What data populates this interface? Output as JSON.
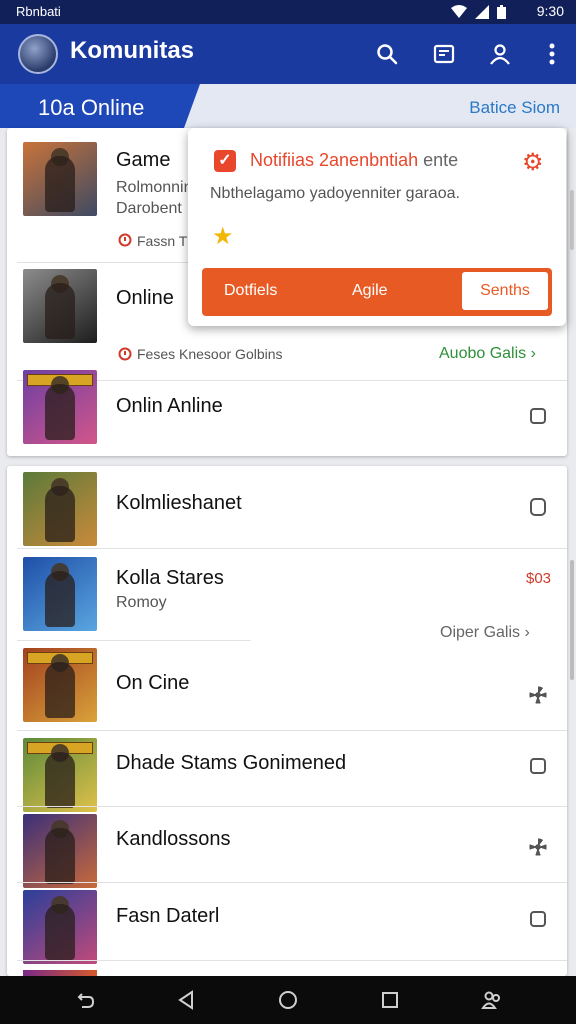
{
  "status_bar": {
    "carrier": "Rbnbati",
    "time": "9:30"
  },
  "app_bar": {
    "title": "Komunitas",
    "icons": [
      "search-icon",
      "news-icon",
      "profile-icon",
      "more-icon"
    ]
  },
  "tabs": {
    "active": "10a Online",
    "right": "Batice Siom"
  },
  "colors": {
    "primary": "#1a3aa0",
    "accent": "#e85a24",
    "link_green": "#2f8f3a"
  },
  "top_card": {
    "rows": [
      {
        "title": "Game",
        "subtitle": "Rolmonnin",
        "subtitle2": "Darobent",
        "meta": "Fassn T",
        "thumb_colors": [
          "#c9733a",
          "#3d4a63"
        ]
      },
      {
        "title": "Online",
        "meta": "Feses Knesoor Golbins",
        "link": "Auobo Galis",
        "thumb_colors": [
          "#8c8c8c",
          "#1d1d1d"
        ]
      },
      {
        "title": "Onlin Anline",
        "thumb_colors": [
          "#6d3fa3",
          "#d2568a"
        ],
        "banner": true,
        "right_icon": "checkbox-icon"
      }
    ]
  },
  "list": [
    {
      "title": "Kolmlieshanet",
      "right_icon": "hexagon-icon",
      "thumb_colors": [
        "#5b7a3a",
        "#c98a3a"
      ]
    },
    {
      "title": "Kolla Stares",
      "subtitle": "Romoy",
      "right_text": "$03",
      "link": "Oiper Galis",
      "thumb_colors": [
        "#1f4fa8",
        "#5aa6e0"
      ]
    },
    {
      "title": "On Cine",
      "right_icon": "gear-icon",
      "thumb_colors": [
        "#a3401f",
        "#d9a23a"
      ],
      "banner": true
    },
    {
      "title": "Dhade Stams Gonimened",
      "right_icon": "checkbox-icon",
      "thumb_colors": [
        "#5c8a3a",
        "#e0c14a"
      ],
      "banner": true
    },
    {
      "title": "Kandlossons",
      "right_icon": "gear-icon",
      "thumb_colors": [
        "#3a2f7a",
        "#c96a3a"
      ]
    },
    {
      "title": "Fasn Daterl",
      "right_icon": "checkbox-icon",
      "thumb_colors": [
        "#2a3f9a",
        "#c24a7a"
      ]
    }
  ],
  "popup": {
    "title": "Notifiias 2anenbntiah",
    "title_tail": "ente",
    "body": "Nbthelagamo yadoyenniter garaoa.",
    "buttons": [
      "Dotfiels",
      "Agile",
      "Senths"
    ]
  },
  "nav_bar": {
    "icons": [
      "back-swipe-icon",
      "back-icon",
      "home-icon",
      "recents-icon",
      "accounts-icon"
    ]
  }
}
